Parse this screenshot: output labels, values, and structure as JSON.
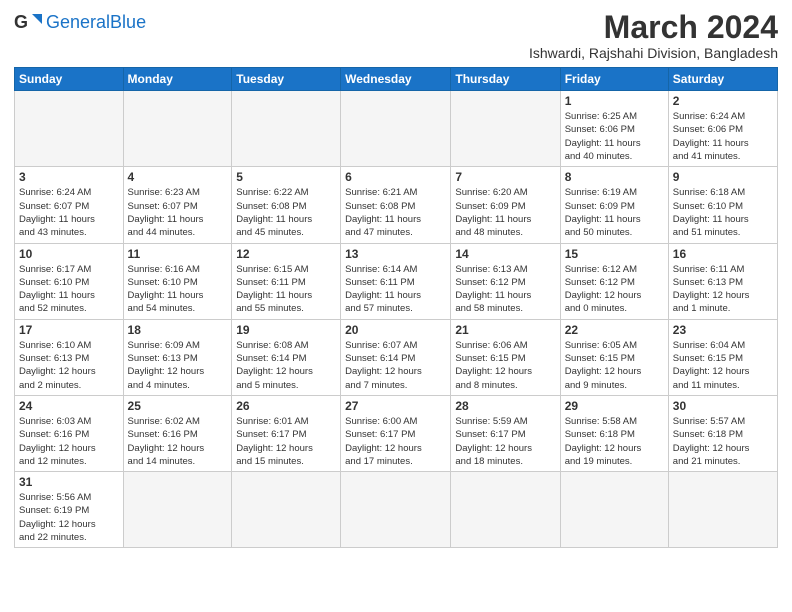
{
  "logo": {
    "general": "General",
    "blue": "Blue"
  },
  "title": {
    "month_year": "March 2024",
    "location": "Ishwardi, Rajshahi Division, Bangladesh"
  },
  "weekdays": [
    "Sunday",
    "Monday",
    "Tuesday",
    "Wednesday",
    "Thursday",
    "Friday",
    "Saturday"
  ],
  "weeks": [
    [
      {
        "day": "",
        "info": ""
      },
      {
        "day": "",
        "info": ""
      },
      {
        "day": "",
        "info": ""
      },
      {
        "day": "",
        "info": ""
      },
      {
        "day": "",
        "info": ""
      },
      {
        "day": "1",
        "info": "Sunrise: 6:25 AM\nSunset: 6:06 PM\nDaylight: 11 hours\nand 40 minutes."
      },
      {
        "day": "2",
        "info": "Sunrise: 6:24 AM\nSunset: 6:06 PM\nDaylight: 11 hours\nand 41 minutes."
      }
    ],
    [
      {
        "day": "3",
        "info": "Sunrise: 6:24 AM\nSunset: 6:07 PM\nDaylight: 11 hours\nand 43 minutes."
      },
      {
        "day": "4",
        "info": "Sunrise: 6:23 AM\nSunset: 6:07 PM\nDaylight: 11 hours\nand 44 minutes."
      },
      {
        "day": "5",
        "info": "Sunrise: 6:22 AM\nSunset: 6:08 PM\nDaylight: 11 hours\nand 45 minutes."
      },
      {
        "day": "6",
        "info": "Sunrise: 6:21 AM\nSunset: 6:08 PM\nDaylight: 11 hours\nand 47 minutes."
      },
      {
        "day": "7",
        "info": "Sunrise: 6:20 AM\nSunset: 6:09 PM\nDaylight: 11 hours\nand 48 minutes."
      },
      {
        "day": "8",
        "info": "Sunrise: 6:19 AM\nSunset: 6:09 PM\nDaylight: 11 hours\nand 50 minutes."
      },
      {
        "day": "9",
        "info": "Sunrise: 6:18 AM\nSunset: 6:10 PM\nDaylight: 11 hours\nand 51 minutes."
      }
    ],
    [
      {
        "day": "10",
        "info": "Sunrise: 6:17 AM\nSunset: 6:10 PM\nDaylight: 11 hours\nand 52 minutes."
      },
      {
        "day": "11",
        "info": "Sunrise: 6:16 AM\nSunset: 6:10 PM\nDaylight: 11 hours\nand 54 minutes."
      },
      {
        "day": "12",
        "info": "Sunrise: 6:15 AM\nSunset: 6:11 PM\nDaylight: 11 hours\nand 55 minutes."
      },
      {
        "day": "13",
        "info": "Sunrise: 6:14 AM\nSunset: 6:11 PM\nDaylight: 11 hours\nand 57 minutes."
      },
      {
        "day": "14",
        "info": "Sunrise: 6:13 AM\nSunset: 6:12 PM\nDaylight: 11 hours\nand 58 minutes."
      },
      {
        "day": "15",
        "info": "Sunrise: 6:12 AM\nSunset: 6:12 PM\nDaylight: 12 hours\nand 0 minutes."
      },
      {
        "day": "16",
        "info": "Sunrise: 6:11 AM\nSunset: 6:13 PM\nDaylight: 12 hours\nand 1 minute."
      }
    ],
    [
      {
        "day": "17",
        "info": "Sunrise: 6:10 AM\nSunset: 6:13 PM\nDaylight: 12 hours\nand 2 minutes."
      },
      {
        "day": "18",
        "info": "Sunrise: 6:09 AM\nSunset: 6:13 PM\nDaylight: 12 hours\nand 4 minutes."
      },
      {
        "day": "19",
        "info": "Sunrise: 6:08 AM\nSunset: 6:14 PM\nDaylight: 12 hours\nand 5 minutes."
      },
      {
        "day": "20",
        "info": "Sunrise: 6:07 AM\nSunset: 6:14 PM\nDaylight: 12 hours\nand 7 minutes."
      },
      {
        "day": "21",
        "info": "Sunrise: 6:06 AM\nSunset: 6:15 PM\nDaylight: 12 hours\nand 8 minutes."
      },
      {
        "day": "22",
        "info": "Sunrise: 6:05 AM\nSunset: 6:15 PM\nDaylight: 12 hours\nand 9 minutes."
      },
      {
        "day": "23",
        "info": "Sunrise: 6:04 AM\nSunset: 6:15 PM\nDaylight: 12 hours\nand 11 minutes."
      }
    ],
    [
      {
        "day": "24",
        "info": "Sunrise: 6:03 AM\nSunset: 6:16 PM\nDaylight: 12 hours\nand 12 minutes."
      },
      {
        "day": "25",
        "info": "Sunrise: 6:02 AM\nSunset: 6:16 PM\nDaylight: 12 hours\nand 14 minutes."
      },
      {
        "day": "26",
        "info": "Sunrise: 6:01 AM\nSunset: 6:17 PM\nDaylight: 12 hours\nand 15 minutes."
      },
      {
        "day": "27",
        "info": "Sunrise: 6:00 AM\nSunset: 6:17 PM\nDaylight: 12 hours\nand 17 minutes."
      },
      {
        "day": "28",
        "info": "Sunrise: 5:59 AM\nSunset: 6:17 PM\nDaylight: 12 hours\nand 18 minutes."
      },
      {
        "day": "29",
        "info": "Sunrise: 5:58 AM\nSunset: 6:18 PM\nDaylight: 12 hours\nand 19 minutes."
      },
      {
        "day": "30",
        "info": "Sunrise: 5:57 AM\nSunset: 6:18 PM\nDaylight: 12 hours\nand 21 minutes."
      }
    ],
    [
      {
        "day": "31",
        "info": "Sunrise: 5:56 AM\nSunset: 6:19 PM\nDaylight: 12 hours\nand 22 minutes."
      },
      {
        "day": "",
        "info": ""
      },
      {
        "day": "",
        "info": ""
      },
      {
        "day": "",
        "info": ""
      },
      {
        "day": "",
        "info": ""
      },
      {
        "day": "",
        "info": ""
      },
      {
        "day": "",
        "info": ""
      }
    ]
  ]
}
